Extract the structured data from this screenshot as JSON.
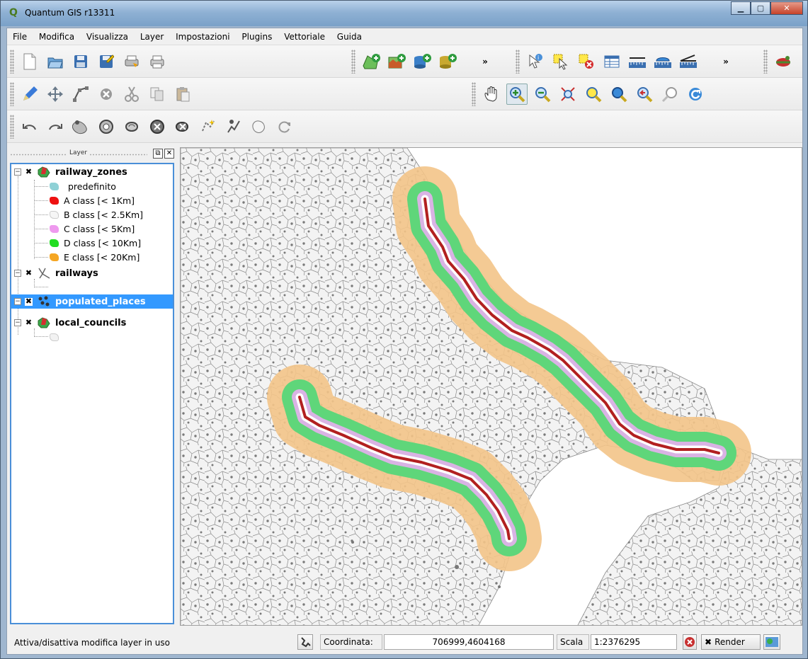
{
  "window": {
    "title": "Quantum GIS r13311"
  },
  "menu": [
    "File",
    "Modifica",
    "Visualizza",
    "Layer",
    "Impostazioni",
    "Plugins",
    "Vettoriale",
    "Guida"
  ],
  "panel": {
    "title": "Layer"
  },
  "layers": {
    "railway_zones": {
      "name": "railway_zones",
      "classes": [
        {
          "label": "predefinito",
          "color": "#8fd1d6"
        },
        {
          "label": "A class [< 1Km]",
          "color": "#ee1111"
        },
        {
          "label": "B class [< 2.5Km]",
          "color": "#f6f6f6"
        },
        {
          "label": "C class [< 5Km]",
          "color": "#ee99ee"
        },
        {
          "label": "D class [< 10Km]",
          "color": "#22dd22"
        },
        {
          "label": "E class [< 20Km]",
          "color": "#f5a623"
        }
      ]
    },
    "railways": {
      "name": "railways"
    },
    "populated_places": {
      "name": "populated_places"
    },
    "local_councils": {
      "name": "local_councils"
    }
  },
  "status": {
    "message": "Attiva/disattiva modifica layer in uso",
    "coord_label": "Coordinata:",
    "coord_value": "706999,4604168",
    "scale_label": "Scala",
    "scale_value": "1:2376295",
    "render_label": "Render"
  },
  "colors": {
    "zone_e": "#f5c98a",
    "zone_d": "#5fd67a",
    "zone_c": "#ddb7e6",
    "zone_b": "#ffffff",
    "zone_a": "#b22020",
    "selection": "#3399ff"
  }
}
